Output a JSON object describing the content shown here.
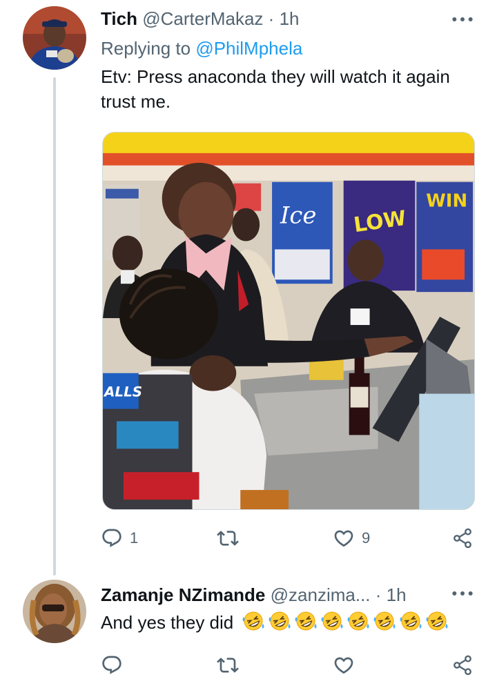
{
  "tweet": {
    "author_name": "Tich",
    "handle": "@CarterMakaz",
    "separator": "·",
    "time": "1h",
    "replying_prefix": "Replying to",
    "replying_to": "@PhilMphela",
    "text": "Etv: Press anaconda they will watch it again trust me.",
    "media": {
      "sign_ice": "Ice",
      "sign_low": "LOW",
      "sign_win": "WIN",
      "sign_halls": "ALLS"
    },
    "reply_count": "1",
    "retweet_count": "",
    "like_count": "9"
  },
  "reply": {
    "author_name": "Zamanje NZimande",
    "handle": "@zanzima...",
    "separator": "·",
    "time": "1h",
    "text": "And yes they did",
    "emoji_count": 8
  },
  "icons": {
    "reply": "reply-icon",
    "retweet": "retweet-icon",
    "like": "heart-icon",
    "share": "share-icon",
    "more": "more-dots-icon",
    "emoji": "rolling-on-floor-laughing-emoji"
  },
  "colors": {
    "text": "#0f1419",
    "muted": "#536471",
    "link": "#1d9bf0",
    "thread_line": "#cfd9de"
  }
}
